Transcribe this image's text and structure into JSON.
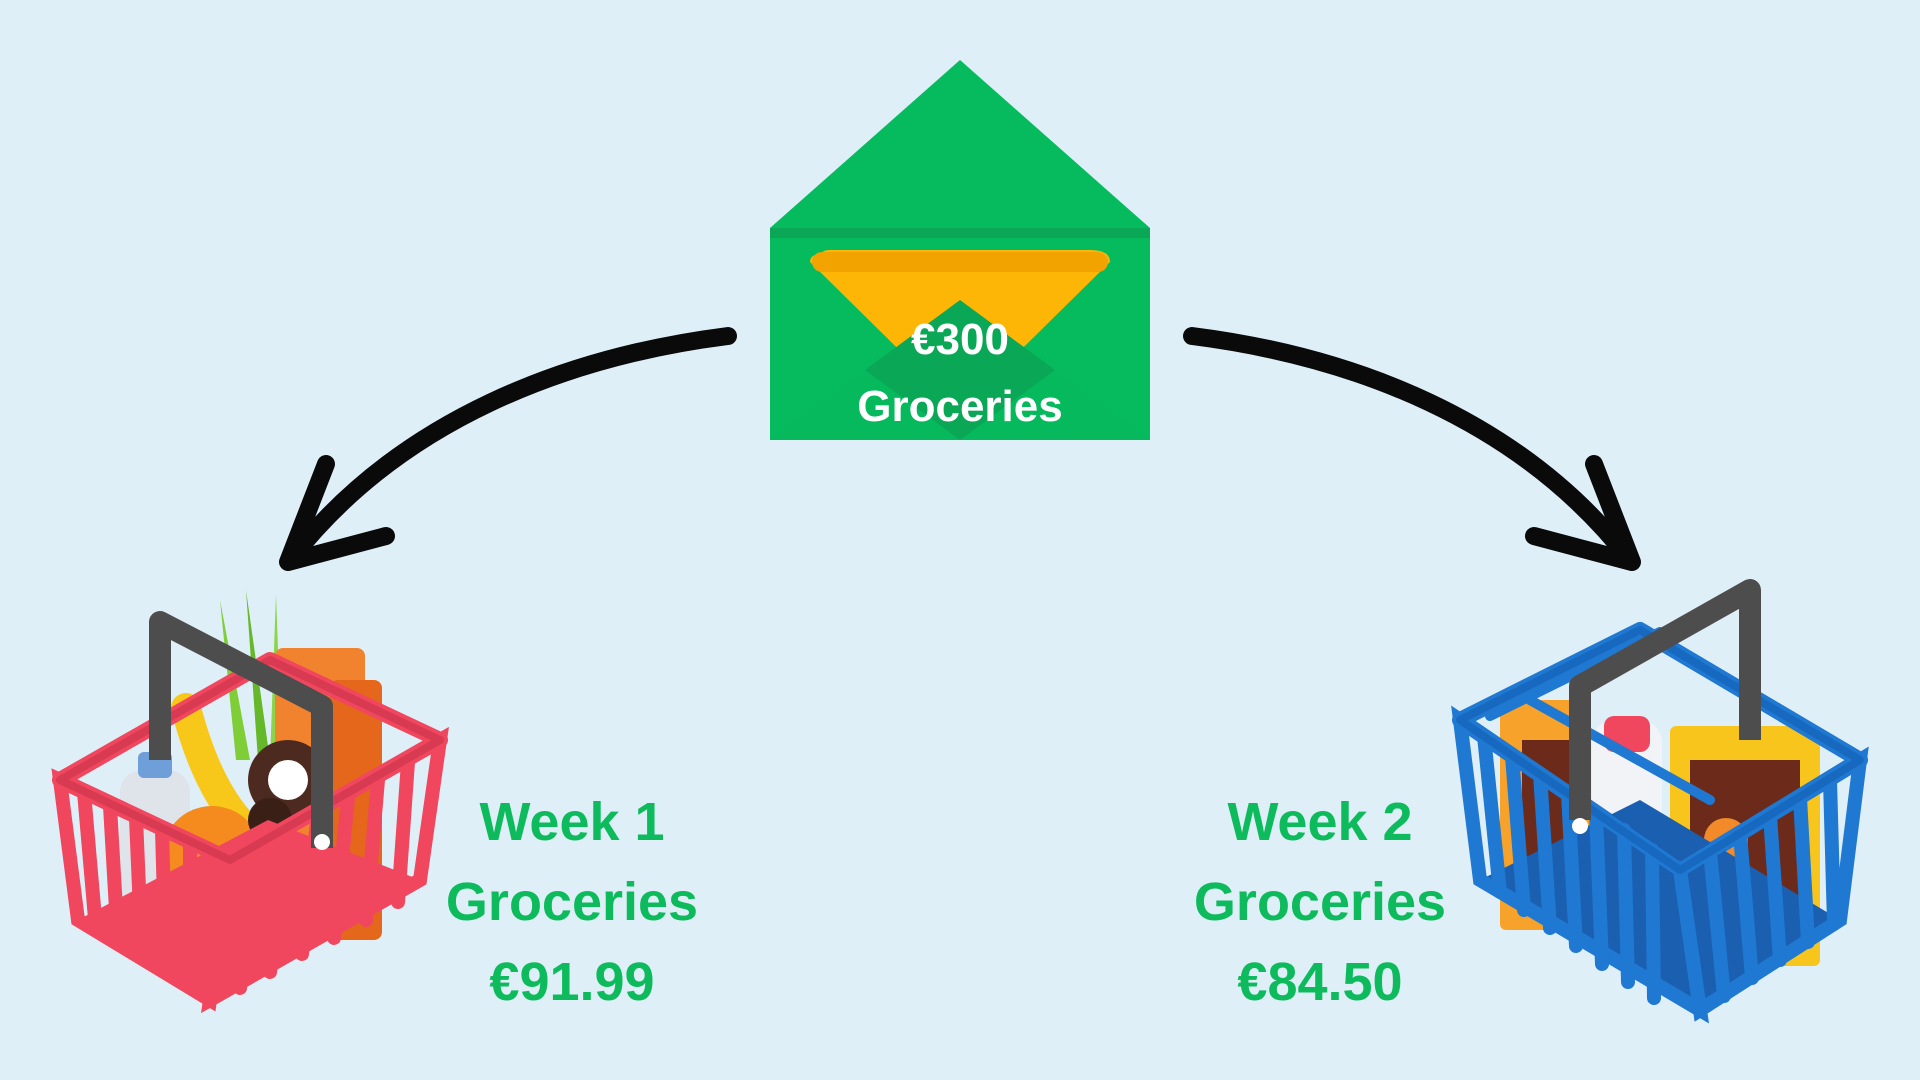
{
  "envelope": {
    "amount": "€300",
    "title": "Groceries",
    "colors": {
      "body": "#05bb5e",
      "flap": "#0aa756",
      "letter": "#fdb605"
    }
  },
  "weeks": [
    {
      "week": "Week 1",
      "category": "Groceries",
      "amount": "€91.99",
      "basket_color": "#f0475f",
      "basket_icon": "red-grocery-basket-icon"
    },
    {
      "week": "Week 2",
      "category": "Groceries",
      "amount": "€84.50",
      "basket_color": "#1f78d1",
      "basket_icon": "blue-grocery-basket-icon"
    }
  ],
  "colors": {
    "background": "#dfeff8",
    "label_text": "#0dbb5c",
    "arrow": "#0a0a0a"
  }
}
